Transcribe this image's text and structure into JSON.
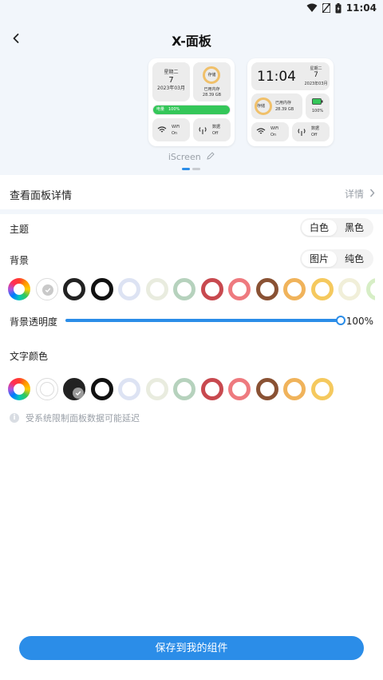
{
  "status": {
    "time": "11:04"
  },
  "header": {
    "title": "X-面板"
  },
  "preview": {
    "left": {
      "weekday": "星期二",
      "day": "7",
      "date": "2023年03月",
      "storage_ring": "存储",
      "storage_label": "已用内存",
      "storage_value": "28.39 GB",
      "battery_label": "电量",
      "battery_value": "100%",
      "battery_fill": 1.0,
      "wifi_label": "WiFi",
      "wifi_state": "On",
      "data_label": "数据",
      "data_state": "Off"
    },
    "right": {
      "time": "11:04",
      "weekday": "星期二",
      "day": "7",
      "date": "2023年03月",
      "storage_ring": "存储",
      "storage_label": "已用内存",
      "storage_value": "28.39 GB",
      "battery_value": "100%",
      "wifi_label": "WiFi",
      "wifi_state": "On",
      "data_label": "数据",
      "data_state": "Off"
    },
    "name": "iScreen"
  },
  "details": {
    "label": "查看面板详情",
    "value": "详情"
  },
  "theme": {
    "label": "主题",
    "options": [
      "白色",
      "黑色"
    ],
    "selected": "白色"
  },
  "background": {
    "label": "背景",
    "options": [
      "图片",
      "纯色"
    ],
    "selected": "图片"
  },
  "bg_swatches": [
    "gradient",
    "#ffffff",
    "#222222",
    "#111111",
    "#dde3f3",
    "#e9ecdf",
    "#b6d2bd",
    "#c8494f",
    "#ee7a7f",
    "#8a5234",
    "#f0b35b",
    "#f5c95e",
    "#f1efd9",
    "#d7eec6"
  ],
  "opacity": {
    "label": "背景透明度",
    "value": "100%",
    "level": 1.0
  },
  "text_color": {
    "label": "文字颜色"
  },
  "text_swatches": [
    "gradient",
    "#ffffff",
    "#222222",
    "#111111",
    "#dde3f3",
    "#e9ecdf",
    "#b6d2bd",
    "#c8494f",
    "#ee7a7f",
    "#8a5234",
    "#f0b35b",
    "#f5c95e"
  ],
  "notice": "受系统限制面板数据可能延迟",
  "save_button": "保存到我的组件",
  "colors": {
    "accent": "#2b8de8",
    "battery_green": "#34c759",
    "storage_ring": "#f0c06a"
  }
}
